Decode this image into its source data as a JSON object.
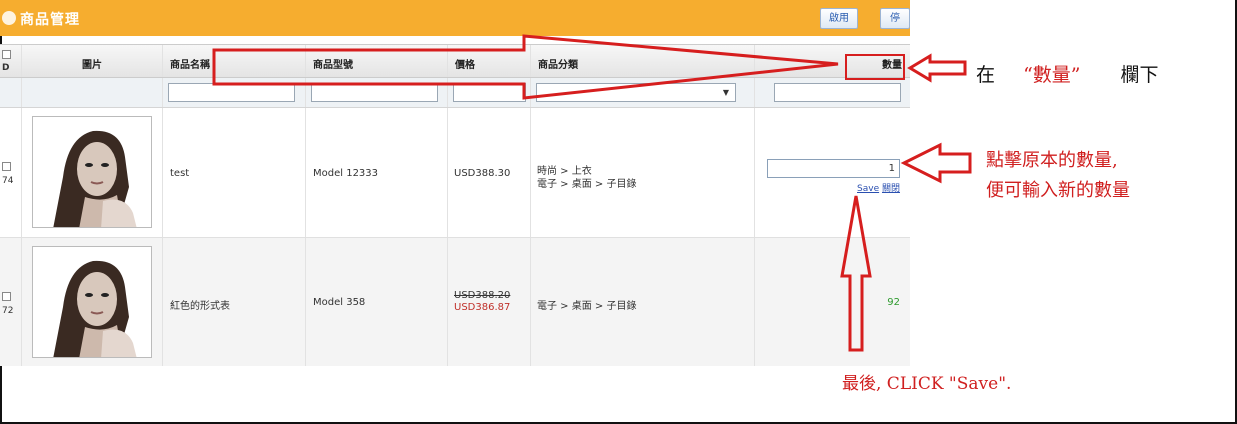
{
  "window": {
    "title": "商品管理",
    "buttons": {
      "enable": "啟用",
      "disable": "停用"
    }
  },
  "table": {
    "columns": {
      "id": "D",
      "image": "圖片",
      "name": "商品名稱",
      "model": "商品型號",
      "price": "價格",
      "category": "商品分類",
      "quantity": "數量"
    },
    "rows": [
      {
        "id": "74",
        "name": "test",
        "model": "Model 12333",
        "price": "USD388.30",
        "category_lines": [
          "時尚 > 上衣",
          "電子 > 桌面 > 子目錄"
        ],
        "quantity_input": "1",
        "save_link": "Save",
        "close_link": "關閉"
      },
      {
        "id": "72",
        "name": "紅色的形式表",
        "model": "Model 358",
        "price_old": "USD388.20",
        "price_new": "USD386.87",
        "category_lines": [
          "電子 > 桌面 > 子目錄"
        ],
        "quantity": "92"
      }
    ]
  },
  "annotations": {
    "top_prefix": "在",
    "top_quoted": "“數量”",
    "top_suffix": "欄下",
    "mid_line1": "點擊原本的數量,",
    "mid_line2": "便可輸入新的數量",
    "bottom": "最後, CLICK \"Save\"."
  },
  "colors": {
    "header_bar": "#f6ad2f",
    "annotation_red": "#d61e1e",
    "sale_price": "#c0302a",
    "quantity_green": "#2d9a2d",
    "link_blue": "#2a4fb0"
  }
}
